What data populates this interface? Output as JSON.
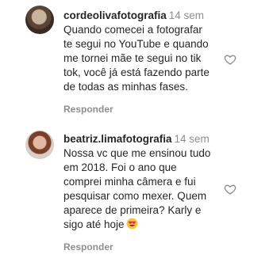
{
  "comments": [
    {
      "username": "cordeolivafotografia",
      "time": "14 sem",
      "text": "Quando comecei a fotografar\nte segui no YouTube e quando\nme tornei mãe te segui no tik\ntok, você já está fazendo parte\nde todas as minhas fases.",
      "reply_label": "Responder",
      "like_icon": "heart-outline-icon"
    },
    {
      "username": "beatriz.limafotografia",
      "time": "14 sem",
      "text": "Nossa vc que me ensinou tudo\nem 2018. Foi o ano que\ncomprei minha câmera e fui\npesquisar como mexer. Quem\naparece de primeira? Karly e\nsigo até hoje",
      "emoji": "smiling-face-with-heart-eyes-emoji",
      "reply_label": "Responder",
      "like_icon": "heart-outline-icon"
    }
  ]
}
